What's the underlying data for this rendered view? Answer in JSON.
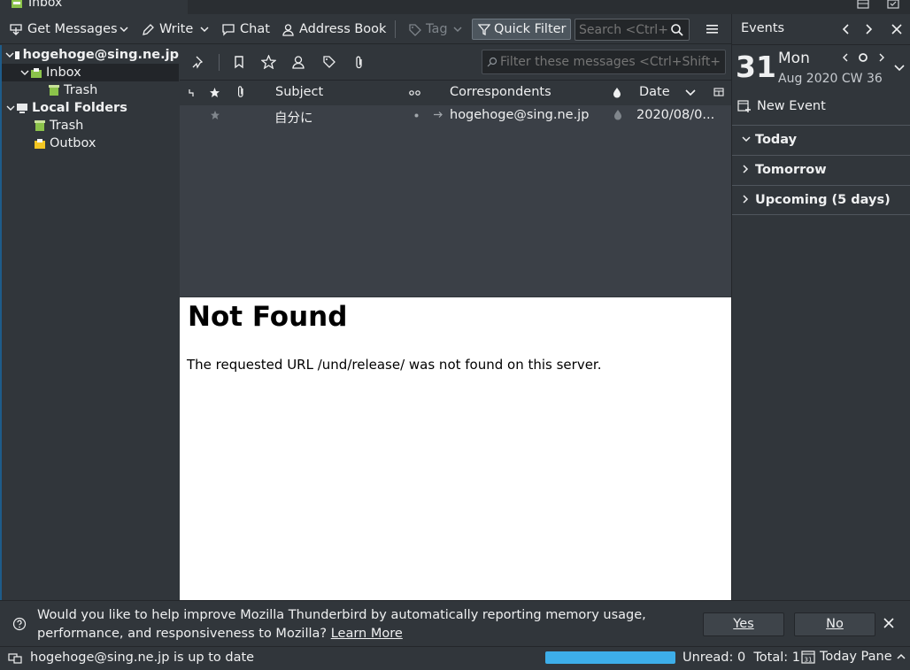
{
  "tab": {
    "title": "Inbox"
  },
  "toolbar": {
    "get_messages": "Get Messages",
    "write": "Write",
    "chat": "Chat",
    "address_book": "Address Book",
    "tag": "Tag",
    "quick_filter": "Quick Filter",
    "search_placeholder": "Search <Ctrl+K>"
  },
  "folders": {
    "account": "hogehoge@sing.ne.jp",
    "inbox": "Inbox",
    "account_trash": "Trash",
    "local_folders": "Local Folders",
    "local_trash": "Trash",
    "outbox": "Outbox"
  },
  "quick_filter": {
    "placeholder": "Filter these messages <Ctrl+Shift+K>"
  },
  "thread": {
    "columns": {
      "subject": "Subject",
      "correspondents": "Correspondents",
      "date": "Date"
    },
    "rows": [
      {
        "subject": "自分に",
        "correspondent": "hogehoge@sing.ne.jp",
        "date": "2020/08/0..."
      }
    ]
  },
  "message": {
    "title": "Not Found",
    "body": "The requested URL /und/release/ was not found on this server."
  },
  "today_pane": {
    "title": "Events",
    "day": "31",
    "weekday": "Mon",
    "month_year": "Aug 2020",
    "week": "CW 36",
    "new_event": "New Event",
    "sections": [
      "Today",
      "Tomorrow",
      "Upcoming (5 days)"
    ]
  },
  "notification": {
    "text": "Would you like to help improve Mozilla Thunderbird by automatically reporting memory usage, performance, and responsiveness to Mozilla?",
    "learn_more": "Learn More",
    "yes": "Yes",
    "no": "No"
  },
  "status": {
    "text": "hogehoge@sing.ne.jp is up to date",
    "unread": "Unread: 0",
    "total": "Total: 1",
    "today_pane": "Today Pane"
  },
  "colors": {
    "accent": "#3daee9",
    "background": "#31363b",
    "thread_background": "#3b4047"
  }
}
